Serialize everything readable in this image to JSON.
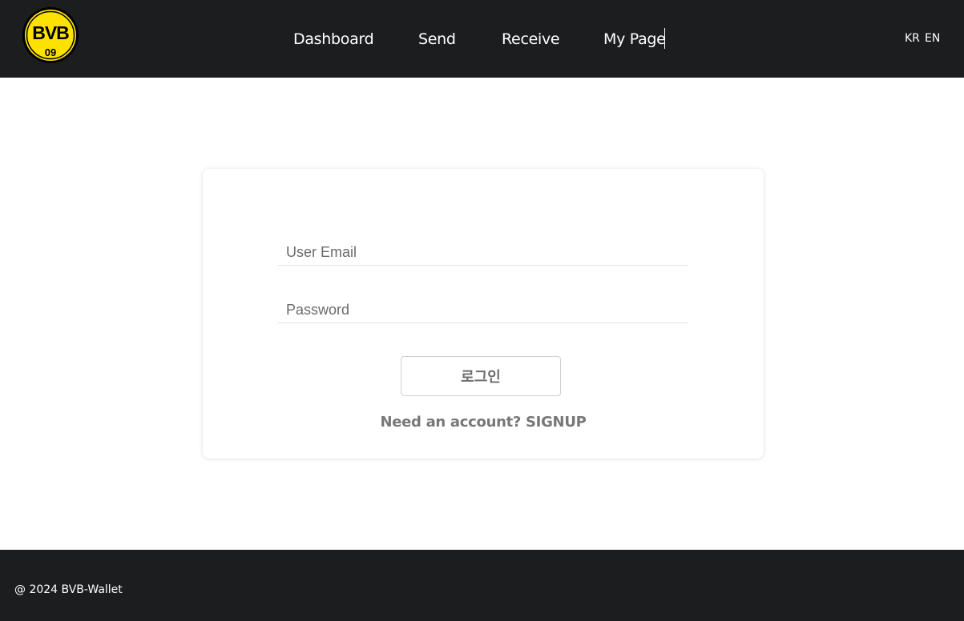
{
  "header": {
    "logo_text": "BVB",
    "logo_number": "09",
    "nav": [
      {
        "label": "Dashboard"
      },
      {
        "label": "Send"
      },
      {
        "label": "Receive"
      },
      {
        "label": "My Page"
      }
    ],
    "languages": [
      "KR",
      "EN"
    ]
  },
  "login": {
    "email_placeholder": "User Email",
    "password_placeholder": "Password",
    "email_value": "",
    "password_value": "",
    "submit_label": "로그인",
    "signup_prompt": "Need an account?",
    "signup_link": "SIGNUP"
  },
  "footer": {
    "copyright": "@ 2024 BVB-Wallet"
  },
  "colors": {
    "bar_background": "#1c1d1f",
    "brand_yellow": "#fde100",
    "brand_black": "#000000"
  }
}
